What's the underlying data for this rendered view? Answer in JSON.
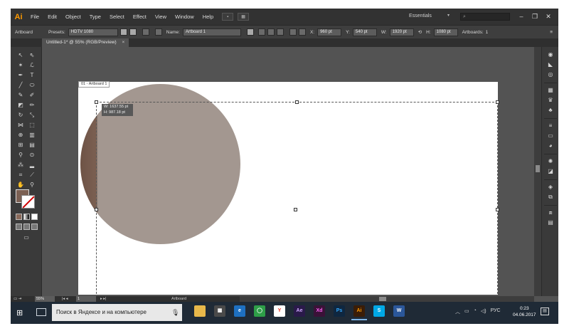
{
  "app": {
    "logo": "Ai",
    "menus": [
      "File",
      "Edit",
      "Object",
      "Type",
      "Select",
      "Effect",
      "View",
      "Window",
      "Help"
    ],
    "workspace": "Essentials",
    "window_controls": [
      "–",
      "❐",
      "✕"
    ]
  },
  "controlbar": {
    "tool_name": "Artboard",
    "presets_label": "Presets:",
    "presets_value": "HDTV 1080",
    "name_label": "Name:",
    "name_value": "Artboard 1",
    "x_label": "X:",
    "x_value": "960 pt",
    "y_label": "Y:",
    "y_value": "540 pt",
    "w_label": "W:",
    "w_value": "1920 pt",
    "h_label": "H:",
    "h_value": "1080 pt",
    "artboards_label": "Artboards:",
    "artboards_value": "1"
  },
  "document": {
    "tab_title": "Untitled-1* @ 55% (RGB/Preview)",
    "tab_close": "×",
    "artboard_label": "01 - Artboard 1",
    "tooltip_w": "W: 1637.55 pt",
    "tooltip_h": "H: 987.18 pt"
  },
  "colors": {
    "fill": "#7b6053",
    "circle_light": "#a39790",
    "circle_dark": "#6e5346",
    "ui_dark": "#323232",
    "ui_mid": "#535353",
    "taskbar": "#1f2a36",
    "accent": "#ff9a00"
  },
  "status": {
    "zoom": "55%",
    "page": "1",
    "tool": "Artboard"
  },
  "taskbar": {
    "search_placeholder": "Поиск в Яндексе и на компьютере",
    "apps": [
      {
        "name": "file-explorer",
        "label": "▬",
        "color": "#e8b84a"
      },
      {
        "name": "calculator",
        "label": "▦",
        "color": "#4a4a4a"
      },
      {
        "name": "edge",
        "label": "e",
        "color": "#1e70c1"
      },
      {
        "name": "app-green",
        "label": "◯",
        "color": "#2e9e48"
      },
      {
        "name": "yandex-browser",
        "label": "Y",
        "color": "#ffffff"
      },
      {
        "name": "after-effects",
        "label": "Ae",
        "color": "#2a1a4a"
      },
      {
        "name": "xd",
        "label": "Xd",
        "color": "#3a1238"
      },
      {
        "name": "photoshop",
        "label": "Ps",
        "color": "#0f2740"
      },
      {
        "name": "illustrator",
        "label": "Ai",
        "color": "#3a1d07"
      },
      {
        "name": "skype",
        "label": "S",
        "color": "#00a8e6"
      },
      {
        "name": "word",
        "label": "W",
        "color": "#2b579a"
      }
    ],
    "lang": "РУС",
    "time": "0:23",
    "date": "04.06.2017"
  }
}
